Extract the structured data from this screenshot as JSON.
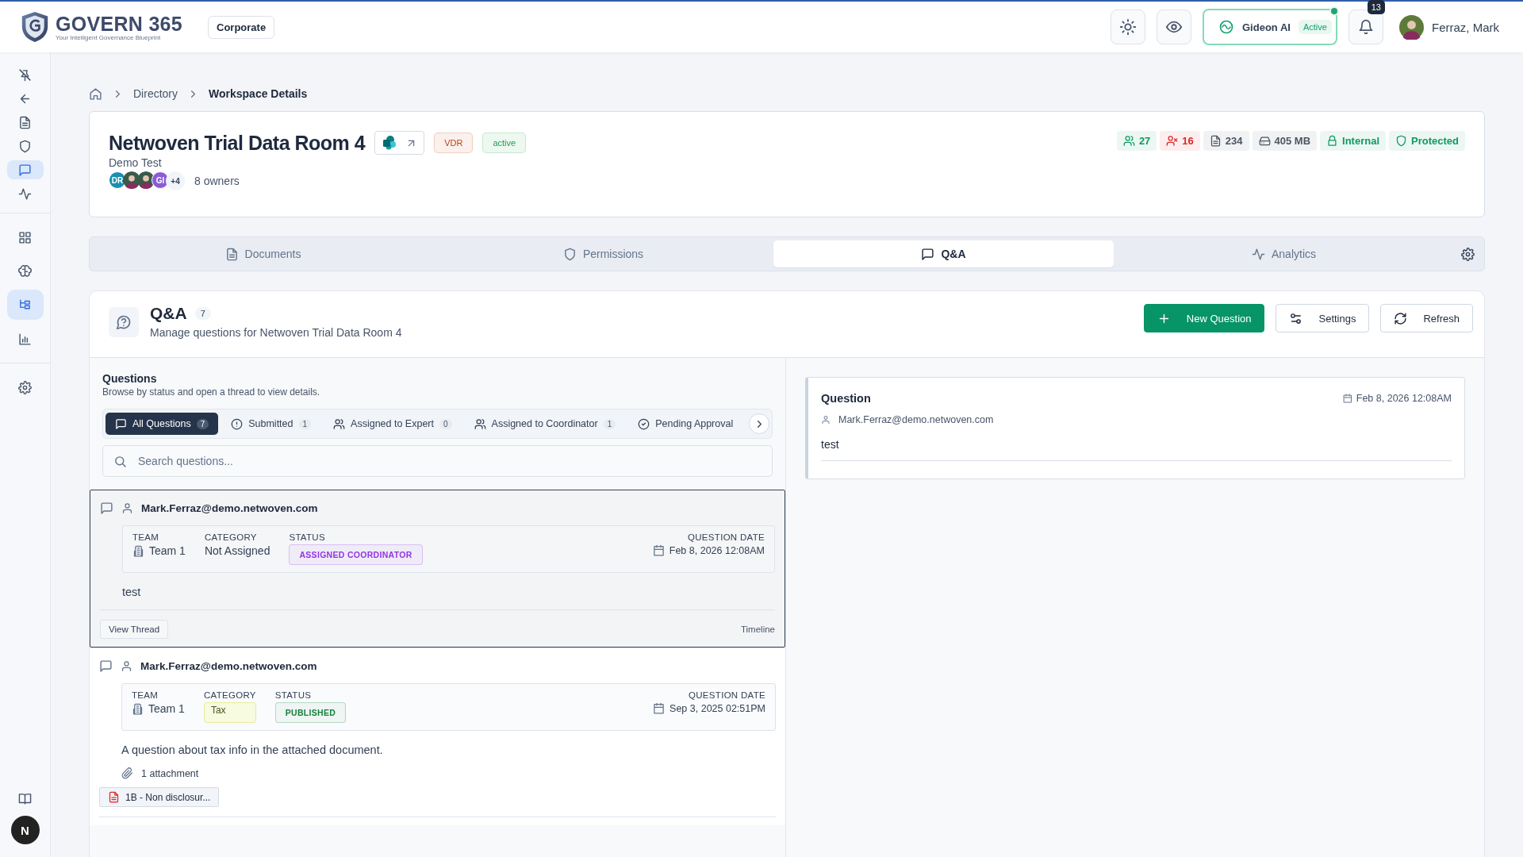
{
  "header": {
    "logo": {
      "title": "GOVERN 365",
      "tagline": "Your Intelligent Governance Blueprint"
    },
    "org_button": "Corporate",
    "assistant": {
      "name": "Gideon AI",
      "status": "Active",
      "online": true
    },
    "notifications": {
      "count": "13"
    },
    "user": {
      "name": "Ferraz, Mark",
      "avatar": {
        "kind": "picture"
      }
    }
  },
  "sidebar": {
    "items": [
      {
        "kind": "pin",
        "selected": false
      },
      {
        "kind": "back",
        "selected": false
      },
      {
        "kind": "document",
        "selected": false
      },
      {
        "kind": "shield",
        "selected": false
      },
      {
        "kind": "chat",
        "selected": true
      },
      {
        "kind": "activity",
        "selected": false
      },
      {
        "kind": "divider"
      },
      {
        "kind": "grid",
        "selected": false
      },
      {
        "kind": "brain",
        "selected": false
      },
      {
        "kind": "tree",
        "selected": true
      },
      {
        "kind": "chart",
        "selected": false
      },
      {
        "kind": "divider"
      },
      {
        "kind": "gear",
        "selected": false
      }
    ],
    "bottom": {
      "avatar_letter": "N"
    }
  },
  "breadcrumb": [
    "Directory",
    "Workspace Details"
  ],
  "workspace": {
    "title": "Netwoven Trial Data Room 4",
    "tags": [
      {
        "label": "VDR",
        "color": "#c2410c"
      },
      {
        "label": "active",
        "color": "#16a34a"
      }
    ],
    "subtitle": "Demo Test",
    "owners": [
      {
        "initials": "DR",
        "color": "#1a8fb0"
      },
      {
        "kind": "picture"
      },
      {
        "kind": "picture"
      },
      {
        "initials": "GI",
        "color": "#8b5cd6"
      }
    ],
    "more": "+4",
    "owners_label": "8 owners",
    "stats": [
      {
        "kind": "members",
        "value": "27",
        "color": "#0f9a62"
      },
      {
        "kind": "external",
        "value": "16",
        "color": "#dc2626"
      },
      {
        "kind": "documents",
        "value": "234",
        "color": "#4b5563"
      },
      {
        "kind": "storage",
        "value": "405 MB",
        "color": "#4b5563"
      },
      {
        "kind": "internal",
        "value": "Internal",
        "color": "#0f9a62"
      },
      {
        "kind": "protected",
        "value": "Protected",
        "color": "#0f9a62"
      }
    ]
  },
  "tabs": [
    {
      "label": "Documents",
      "kind": "document",
      "selected": false
    },
    {
      "label": "Permissions",
      "kind": "shield",
      "selected": false
    },
    {
      "label": "Q&A",
      "kind": "chat",
      "selected": true
    },
    {
      "label": "Analytics",
      "kind": "activity",
      "selected": false
    }
  ],
  "qa": {
    "title": "Q&A",
    "count": "7",
    "subtitle": "Manage questions for Netwoven Trial Data Room 4",
    "buttons": [
      {
        "label": "New Question",
        "kind": "primary"
      },
      {
        "label": "Settings",
        "kind": "settings"
      },
      {
        "label": "Refresh",
        "kind": "refresh"
      }
    ],
    "questions": {
      "heading": "Questions",
      "description": "Browse by status and open a thread to view details.",
      "filters": [
        {
          "label": "All Questions",
          "count": "7",
          "kind": "chat",
          "selected": true
        },
        {
          "label": "Submitted",
          "count": "1",
          "kind": "alert",
          "selected": false
        },
        {
          "label": "Assigned to Expert",
          "count": "0",
          "kind": "users",
          "selected": false
        },
        {
          "label": "Assigned to Coordinator",
          "count": "1",
          "kind": "users",
          "selected": false
        },
        {
          "label": "Pending Approval",
          "kind": "check",
          "selected": false
        }
      ],
      "search": {
        "placeholder": "Search questions..."
      },
      "items": [
        {
          "author": "Mark.Ferraz@demo.netwoven.com",
          "selected": true,
          "labels": {
            "team": "TEAM",
            "category": "CATEGORY",
            "status": "STATUS",
            "date": "QUESTION DATE"
          },
          "team": "Team 1",
          "category": {
            "label": "Not Assigned",
            "kind": "plain"
          },
          "status": {
            "label": "ASSIGNED COORDINATOR",
            "color": "#9333ea"
          },
          "date": "Feb 8, 2026 12:08AM",
          "body": "test",
          "footer": {
            "button": "View Thread",
            "link": "Timeline"
          }
        },
        {
          "author": "Mark.Ferraz@demo.netwoven.com",
          "selected": false,
          "labels": {
            "team": "TEAM",
            "category": "CATEGORY",
            "status": "STATUS",
            "date": "QUESTION DATE"
          },
          "team": "Team 1",
          "category": {
            "label": "Tax",
            "kind": "tag"
          },
          "status": {
            "label": "PUBLISHED",
            "color": "#15803d"
          },
          "date": "Sep 3, 2025 02:51PM",
          "body": "A question about tax info in the attached document.",
          "attachments": {
            "label": "1 attachment",
            "files": [
              "1B - Non disclosur..."
            ]
          }
        }
      ]
    },
    "detail": {
      "title": "Question",
      "date": "Feb 8, 2026 12:08AM",
      "author": "Mark.Ferraz@demo.netwoven.com",
      "body": "test"
    }
  }
}
